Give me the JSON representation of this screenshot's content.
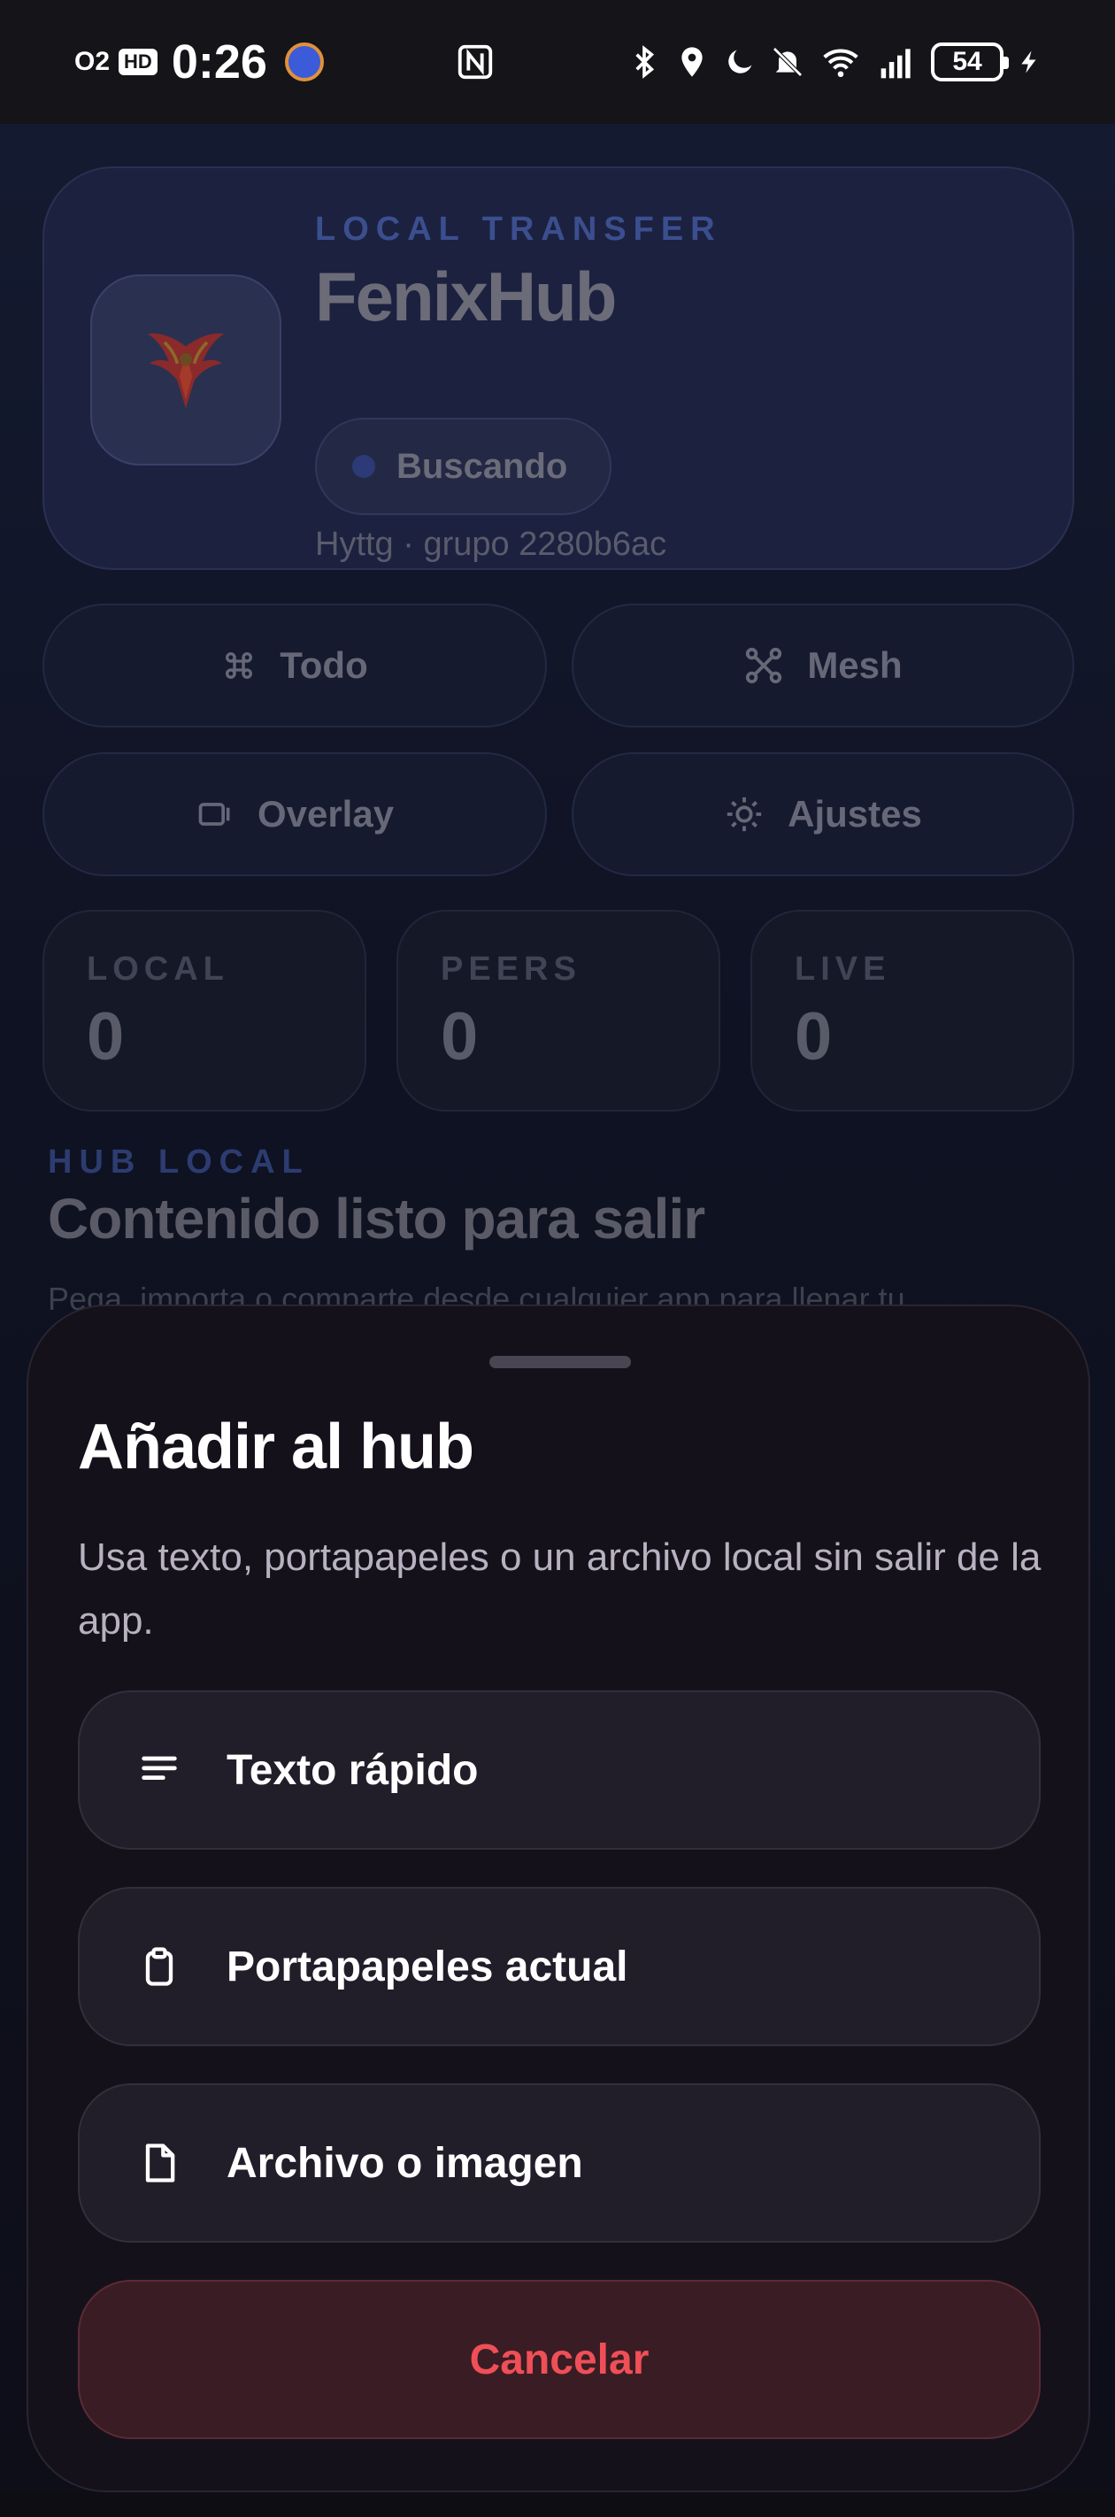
{
  "status_bar": {
    "carrier": "O2",
    "hd_badge": "HD",
    "time": "0:26",
    "battery": "54"
  },
  "hero": {
    "eyebrow": "LOCAL TRANSFER",
    "title": "FenixHub",
    "status": "Buscando",
    "meta": "Hyttg · grupo 2280b6ac"
  },
  "nav": {
    "todo": "Todo",
    "mesh": "Mesh",
    "overlay": "Overlay",
    "ajustes": "Ajustes"
  },
  "stats": [
    {
      "label": "LOCAL",
      "value": "0"
    },
    {
      "label": "PEERS",
      "value": "0"
    },
    {
      "label": "LIVE",
      "value": "0"
    }
  ],
  "section": {
    "eyebrow": "HUB LOCAL",
    "title": "Contenido listo para salir",
    "body": "Pega, importa o comparte desde cualquier app para llenar tu"
  },
  "sheet": {
    "title": "Añadir al hub",
    "subtitle": "Usa texto, portapapeles o un archivo local sin salir de la app.",
    "options": [
      {
        "label": "Texto rápido",
        "icon": "lines-icon"
      },
      {
        "label": "Portapapeles actual",
        "icon": "clipboard-icon"
      },
      {
        "label": "Archivo o imagen",
        "icon": "file-icon"
      }
    ],
    "cancel": "Cancelar"
  },
  "colors": {
    "accent": "#3b4f8f",
    "danger": "#ef4f57",
    "sheet_bg": "#14111b"
  }
}
